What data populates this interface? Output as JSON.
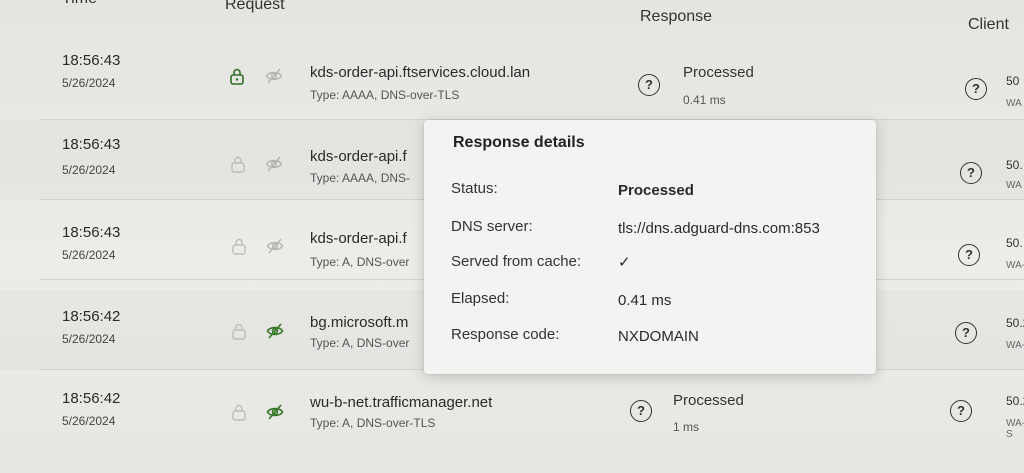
{
  "headers": {
    "time": "Time",
    "request": "Request",
    "response": "Response",
    "client": "Client"
  },
  "rows": [
    {
      "time": "18:56:43",
      "date": "5/26/2024",
      "domain": "kds-order-api.ftservices.cloud.lan",
      "type": "Type: AAAA, DNS-over-TLS",
      "status": "Processed",
      "elapsed": "0.41 ms",
      "client_ip": "50",
      "client_name": "WA"
    },
    {
      "time": "18:56:43",
      "date": "5/26/2024",
      "domain": "kds-order-api.f",
      "type": "Type: AAAA, DNS-",
      "client_ip": "50.",
      "client_name": "WA"
    },
    {
      "time": "18:56:43",
      "date": "5/26/2024",
      "domain": "kds-order-api.f",
      "type": "Type: A, DNS-over",
      "client_ip": "50.",
      "client_name": "WA-"
    },
    {
      "time": "18:56:42",
      "date": "5/26/2024",
      "domain": "bg.microsoft.m",
      "type": "Type: A, DNS-over",
      "client_ip": "50.2",
      "client_name": "WA-"
    },
    {
      "time": "18:56:42",
      "date": "5/26/2024",
      "domain": "wu-b-net.trafficmanager.net",
      "type": "Type: A, DNS-over-TLS",
      "status": "Processed",
      "elapsed": "1 ms",
      "client_ip": "50.2",
      "client_name": "WA-S"
    }
  ],
  "popup": {
    "title": "Response details",
    "status_label": "Status:",
    "status_value": "Processed",
    "dns_label": "DNS server:",
    "dns_value": "tls://dns.adguard-dns.com:853",
    "cache_label": "Served from cache:",
    "cache_value": "✓",
    "elapsed_label": "Elapsed:",
    "elapsed_value": "0.41 ms",
    "code_label": "Response code:",
    "code_value": "NXDOMAIN"
  },
  "icons": {
    "lock": "lock-icon",
    "hidden": "eye-off-icon",
    "help": "question-icon"
  },
  "colors": {
    "eye_active": "#3b7a2d",
    "check": "#3f8f3f"
  }
}
